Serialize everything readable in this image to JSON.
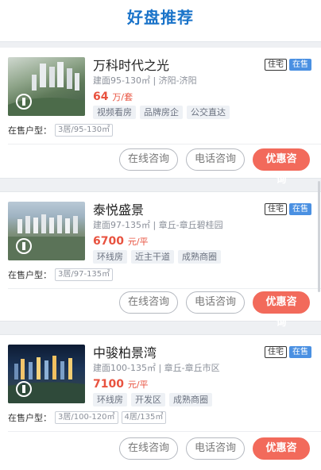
{
  "header": {
    "title": "好盘推荐"
  },
  "listings": [
    {
      "name": "万科时代之光",
      "property_type": "住宅",
      "status": "在售",
      "area": "建面95-130㎡",
      "region": "济阳-济阳",
      "price_value": "64",
      "price_unit": "万/套",
      "tags": [
        "视频看房",
        "品牌房企",
        "公交直达"
      ],
      "units_label": "在售户型：",
      "units": [
        "3居/95-130㎡"
      ],
      "actions": {
        "online": "在线咨询",
        "phone": "电话咨询",
        "deal": "优惠咨询"
      }
    },
    {
      "name": "泰悦盛景",
      "property_type": "住宅",
      "status": "在售",
      "area": "建面97-135㎡",
      "region": "章丘-章丘碧桂园",
      "price_value": "6700",
      "price_unit": "元/平",
      "tags": [
        "环线房",
        "近主干道",
        "成熟商圈"
      ],
      "units_label": "在售户型：",
      "units": [
        "3居/97-135㎡"
      ],
      "actions": {
        "online": "在线咨询",
        "phone": "电话咨询",
        "deal": "优惠咨询"
      }
    },
    {
      "name": "中骏柏景湾",
      "property_type": "住宅",
      "status": "在售",
      "area": "建面100-135㎡",
      "region": "章丘-章丘市区",
      "price_value": "7100",
      "price_unit": "元/平",
      "tags": [
        "环线房",
        "开发区",
        "成熟商圈"
      ],
      "units_label": "在售户型：",
      "units": [
        "3居/100-120㎡",
        "4居/135㎡"
      ],
      "actions": {
        "online": "在线咨询",
        "phone": "电话咨询",
        "deal": "优惠咨询"
      }
    }
  ],
  "colors": {
    "title": "#1a73c9",
    "price": "#e8523f",
    "primary_button": "#f26a5b",
    "sale_badge": "#4a90e2"
  }
}
